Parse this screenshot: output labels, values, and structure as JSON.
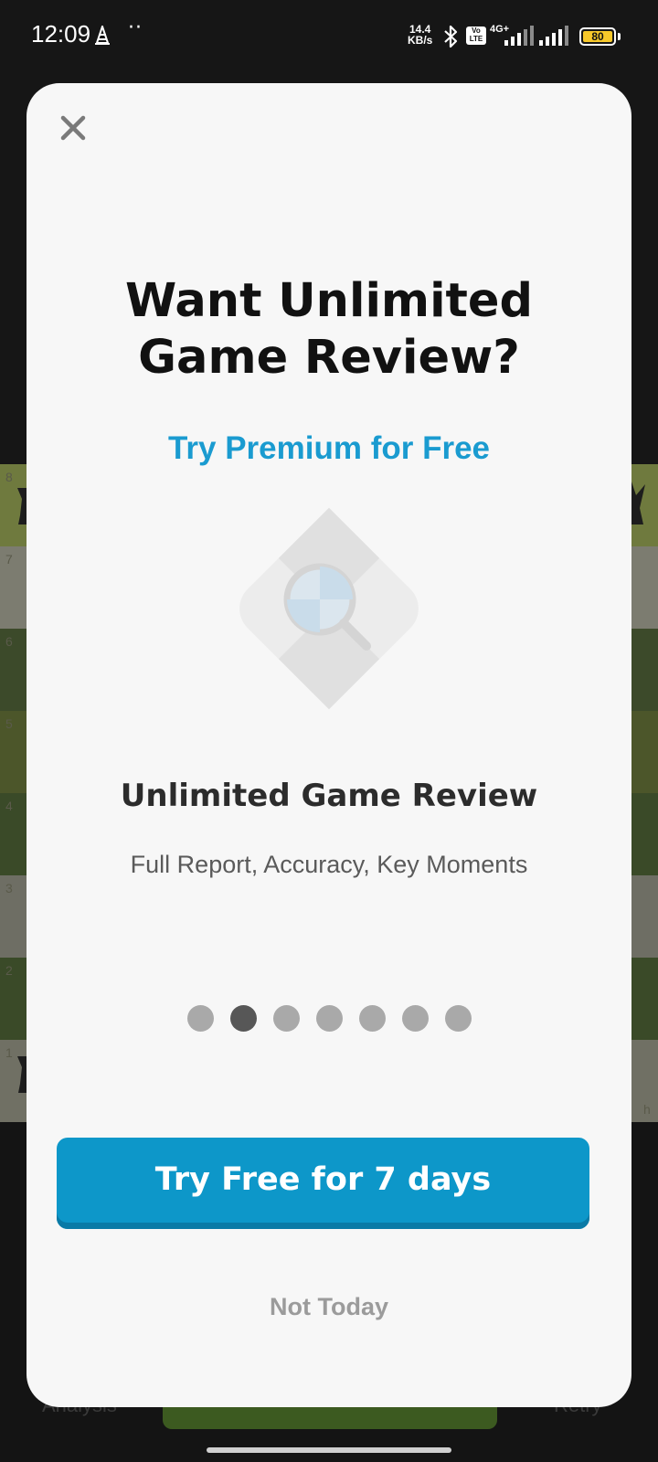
{
  "status_bar": {
    "time": "12:09",
    "notification_icon": "caution-cone-icon",
    "more_indicator": "··",
    "net_speed_value": "14.4",
    "net_speed_unit": "KB/s",
    "bluetooth_icon": "bluetooth-icon",
    "volte_label_top": "Vo",
    "volte_label_bottom": "LTE",
    "network_type": "4G+",
    "battery_level": "80",
    "battery_color": "#f7c82a"
  },
  "background": {
    "rank_labels": [
      "8",
      "7",
      "6",
      "5",
      "4",
      "3",
      "2",
      "1"
    ],
    "file_label": "h",
    "bottom_left_label": "Analysis",
    "bottom_right_label": "Retry"
  },
  "modal": {
    "close_icon": "close-icon",
    "title": "Want Unlimited\nGame Review?",
    "subtitle": "Try Premium for Free",
    "subtitle_color": "#1a9bd0",
    "feature": {
      "icon": "game-review-magnifier-icon",
      "title": "Unlimited Game Review",
      "description": "Full Report, Accuracy, Key Moments"
    },
    "pager": {
      "total": 7,
      "active_index": 1
    },
    "primary_button": {
      "label": "Try Free for 7 days",
      "color": "#0d97c9"
    },
    "secondary_link": "Not Today"
  }
}
